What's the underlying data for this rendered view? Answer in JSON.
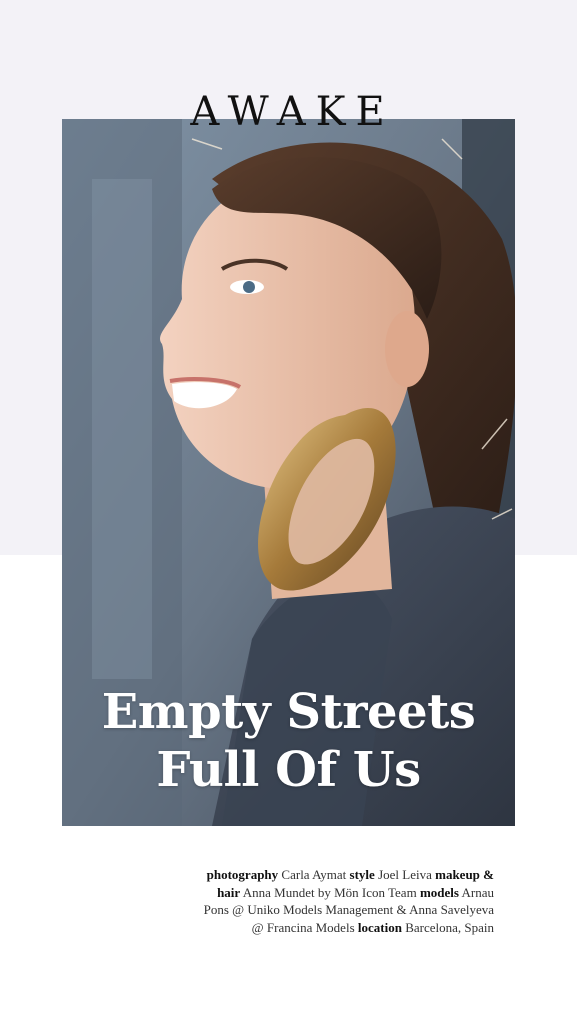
{
  "brand": "AWAKE",
  "headline": {
    "line1": "Empty Streets",
    "line2": "Full Of Us"
  },
  "credits": [
    {
      "role": "photography",
      "name": "Carla Aymat"
    },
    {
      "role": "style",
      "name": "Joel Leiva"
    },
    {
      "role": "makeup & hair",
      "name": "Anna Mundet by Mön Icon Team"
    },
    {
      "role": "models",
      "name": "Arnau Pons @ Uniko Models Management & Anna Savelyeva @ Francina Models"
    },
    {
      "role": "location",
      "name": "Barcelona, Spain"
    }
  ],
  "colors": {
    "top_band": "#f3f2f7",
    "text_dark": "#111111",
    "headline": "#ffffff"
  }
}
